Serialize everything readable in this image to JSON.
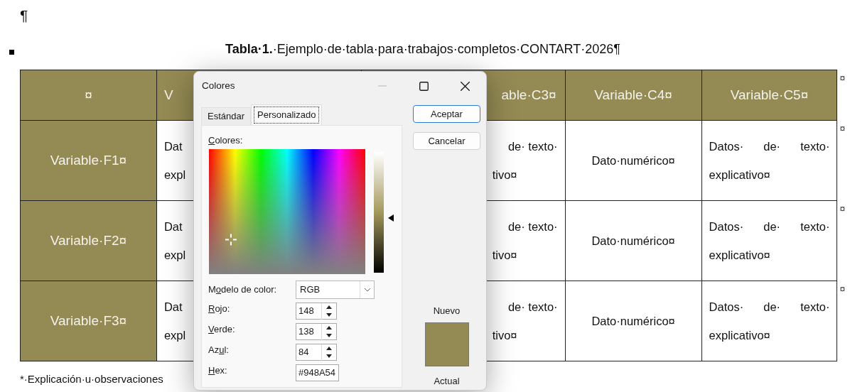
{
  "document": {
    "pilcrow": "¶",
    "caption": "**Tabla·1.**·Ejemplo·de·tabla·para·trabajos·completos·CONTART·2026¶",
    "table": {
      "header": {
        "cells": [
          {
            "kind": "full",
            "text": "¤"
          },
          {
            "kind": "cut_right",
            "lines": [
              "V"
            ]
          },
          {
            "kind": "cut_left",
            "lines": [
              "able·C3¤"
            ]
          },
          {
            "kind": "full",
            "text": "Variable·C4¤"
          },
          {
            "kind": "full",
            "text": "Variable·C5¤"
          }
        ],
        "end_mark": "¤"
      },
      "rows": [
        {
          "cells": [
            {
              "kind": "row_header",
              "text": "Variable·F1¤"
            },
            {
              "kind": "cut_right",
              "lines": [
                "Dat",
                "expl"
              ]
            },
            {
              "kind": "cut_left",
              "lines": [
                "de· texto·",
                "tivo¤"
              ]
            },
            {
              "kind": "full",
              "text": "Dato·numérico¤"
            },
            {
              "kind": "paragraph",
              "text": "Datos· de· texto· explicativo¤"
            }
          ],
          "end_mark": "¤"
        },
        {
          "cells": [
            {
              "kind": "row_header",
              "text": "Variable·F2¤"
            },
            {
              "kind": "cut_right",
              "lines": [
                "Dat",
                "expl"
              ]
            },
            {
              "kind": "cut_left",
              "lines": [
                "de· texto·",
                "tivo¤"
              ]
            },
            {
              "kind": "full",
              "text": "Dato·numérico¤"
            },
            {
              "kind": "paragraph",
              "text": "Datos· de· texto· explicativo¤"
            }
          ],
          "end_mark": "¤"
        },
        {
          "cells": [
            {
              "kind": "row_header",
              "text": "Variable·F3¤"
            },
            {
              "kind": "cut_right",
              "lines": [
                "Dat",
                "expl"
              ]
            },
            {
              "kind": "cut_left",
              "lines": [
                "de· texto·",
                "tivo¤"
              ]
            },
            {
              "kind": "full",
              "text": "Dato·numérico¤"
            },
            {
              "kind": "paragraph",
              "text": "Datos· de· texto· explicativo¤"
            }
          ],
          "end_mark": "¤"
        }
      ]
    },
    "footnote": "*·Explicación·u·observaciones"
  },
  "dialog": {
    "title": "Colores",
    "window_buttons": [
      {
        "kind": "minimize",
        "disabled": true
      },
      {
        "kind": "maximize",
        "disabled": false
      },
      {
        "kind": "close",
        "disabled": false
      }
    ],
    "tabs": [
      {
        "label": "Estándar",
        "selected": false
      },
      {
        "label": "Personalizado",
        "selected": true
      }
    ],
    "buttons": [
      {
        "label": "Aceptar",
        "default": true
      },
      {
        "label": "Cancelar",
        "default": false
      }
    ],
    "spectrum_label": {
      "key": "C",
      "after": "olores:"
    },
    "color_model": {
      "label": {
        "before": "M",
        "key": "o",
        "after": "delo de color:"
      },
      "value": "RGB"
    },
    "fields": [
      {
        "kind": "spin",
        "label": {
          "key": "R",
          "after": "ojo:"
        },
        "value": "148"
      },
      {
        "kind": "spin",
        "label": {
          "key": "V",
          "after": "erde:"
        },
        "value": "138"
      },
      {
        "kind": "spin",
        "label": {
          "before": "Az",
          "key": "u",
          "after": "l:"
        },
        "value": "84"
      },
      {
        "kind": "text",
        "label": {
          "key": "H",
          "after": "ex:"
        },
        "value": "#948A54"
      }
    ],
    "preview": {
      "new_label": "Nuevo",
      "current_label": "Actual"
    }
  }
}
